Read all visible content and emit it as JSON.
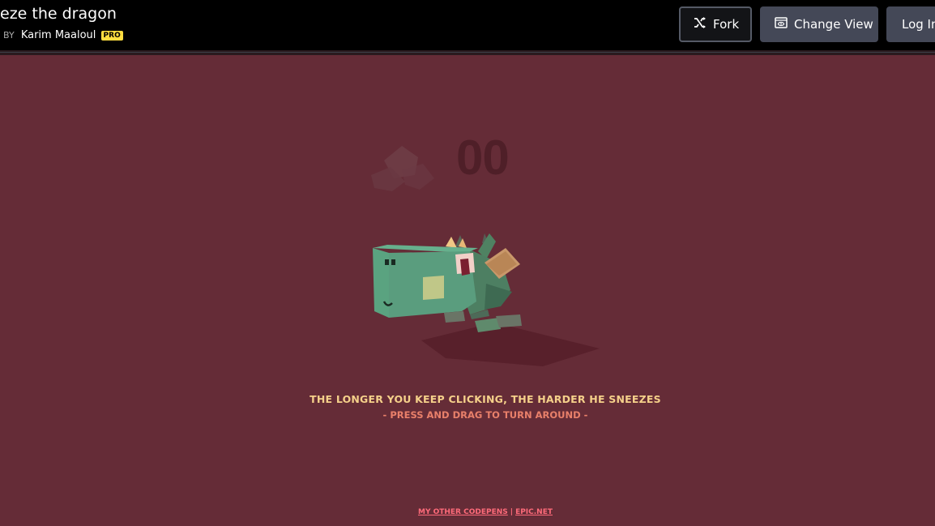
{
  "header": {
    "title": "eze the dragon",
    "by_label": "BY",
    "author": "Karim Maaloul",
    "pro_badge": "PRO",
    "buttons": {
      "fork": "Fork",
      "change_view": "Change View",
      "login": "Log In"
    }
  },
  "game": {
    "counter": "00",
    "instruction": "THE LONGER YOU KEEP CLICKING, THE HARDER HE SNEEZES",
    "hint": "- PRESS AND DRAG TO TURN AROUND -"
  },
  "footer": {
    "link_codepens": "MY OTHER CODEPENS",
    "separator": "|",
    "link_epic": "EPIC.NET"
  },
  "colors": {
    "background": "#652c37",
    "topbar": "#000000",
    "instruction": "#f5d08a",
    "hint": "#e9806a",
    "footer_link": "#ff6b7a"
  }
}
